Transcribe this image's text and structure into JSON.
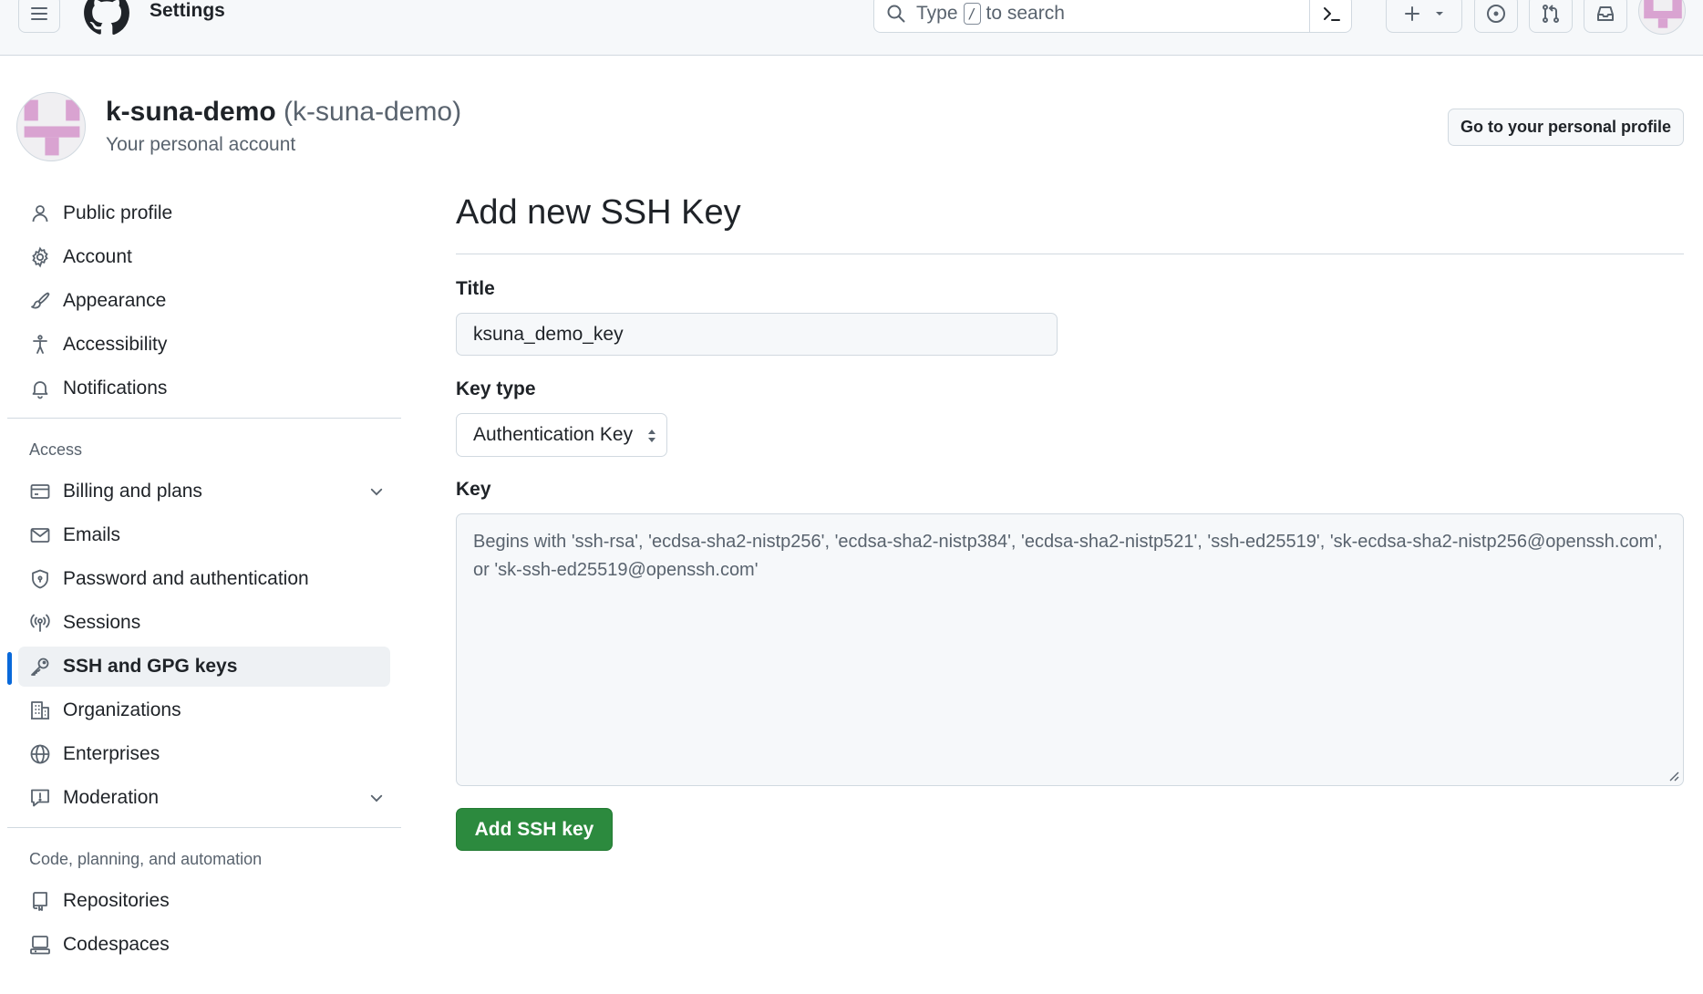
{
  "header": {
    "context_title": "Settings",
    "search_placeholder_before": "Type",
    "search_shortcut_key": "/",
    "search_placeholder_after": "to search"
  },
  "profile": {
    "name": "k-suna-demo",
    "login": "(k-suna-demo)",
    "subtitle": "Your personal account",
    "profile_button": "Go to your personal profile"
  },
  "sidebar": {
    "items": [
      {
        "label": "Public profile",
        "icon": "person-icon"
      },
      {
        "label": "Account",
        "icon": "gear-icon"
      },
      {
        "label": "Appearance",
        "icon": "paintbrush-icon"
      },
      {
        "label": "Accessibility",
        "icon": "accessibility-icon"
      },
      {
        "label": "Notifications",
        "icon": "bell-icon"
      }
    ],
    "access_heading": "Access",
    "access_items": [
      {
        "label": "Billing and plans",
        "icon": "credit-card-icon",
        "expandable": true
      },
      {
        "label": "Emails",
        "icon": "mail-icon"
      },
      {
        "label": "Password and authentication",
        "icon": "shield-lock-icon"
      },
      {
        "label": "Sessions",
        "icon": "broadcast-icon"
      },
      {
        "label": "SSH and GPG keys",
        "icon": "key-icon",
        "selected": true
      },
      {
        "label": "Organizations",
        "icon": "organization-icon"
      },
      {
        "label": "Enterprises",
        "icon": "globe-icon"
      },
      {
        "label": "Moderation",
        "icon": "report-icon",
        "expandable": true
      }
    ],
    "code_heading": "Code, planning, and automation",
    "code_items": [
      {
        "label": "Repositories",
        "icon": "repo-icon"
      },
      {
        "label": "Codespaces",
        "icon": "codespaces-icon"
      }
    ]
  },
  "form": {
    "page_title": "Add new SSH Key",
    "title_label": "Title",
    "title_value": "ksuna_demo_key",
    "key_type_label": "Key type",
    "key_type_value": "Authentication Key",
    "key_label": "Key",
    "key_placeholder": "Begins with 'ssh-rsa', 'ecdsa-sha2-nistp256', 'ecdsa-sha2-nistp384', 'ecdsa-sha2-nistp521', 'ssh-ed25519', 'sk-ecdsa-sha2-nistp256@openssh.com', or 'sk-ssh-ed25519@openssh.com'",
    "submit_label": "Add SSH key"
  },
  "colors": {
    "accent": "#0969da",
    "primary_button": "#2c8a3e",
    "avatar_pink": "#d9a3d1"
  }
}
